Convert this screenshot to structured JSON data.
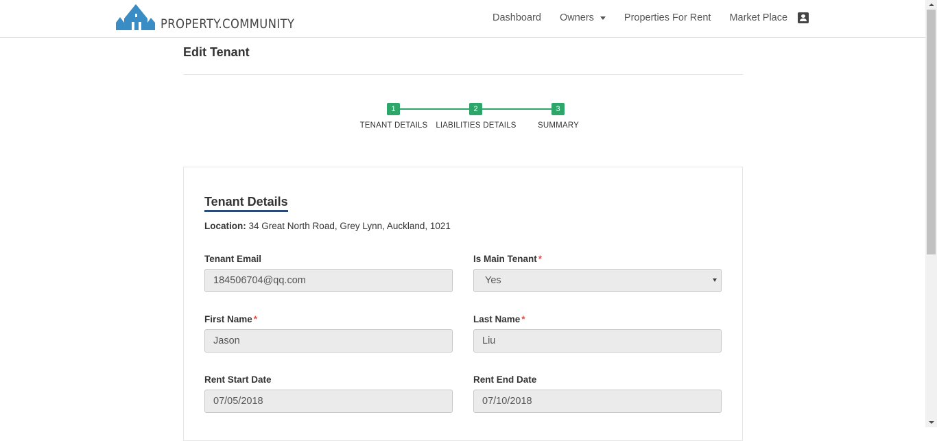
{
  "header": {
    "logo_text": "PROPERTY.COMMUNITY",
    "nav": {
      "dashboard": "Dashboard",
      "owners": "Owners",
      "properties_for_rent": "Properties For Rent",
      "market_place": "Market Place"
    },
    "user_icon": "account-box-icon"
  },
  "page": {
    "title": "Edit Tenant"
  },
  "stepper": {
    "steps": [
      {
        "number": "1",
        "label": "TENANT DETAILS"
      },
      {
        "number": "2",
        "label": "LIABILITIES DETAILS"
      },
      {
        "number": "3",
        "label": "SUMMARY"
      }
    ],
    "color": "#2ea66a"
  },
  "form": {
    "section_title": "Tenant Details",
    "location_label": "Location:",
    "location_value": "34 Great North Road, Grey Lynn, Auckland, 1021",
    "fields": {
      "tenant_email": {
        "label": "Tenant Email",
        "value": "184506704@qq.com"
      },
      "is_main_tenant": {
        "label": "Is Main Tenant",
        "value": "Yes",
        "required": "*"
      },
      "first_name": {
        "label": "First Name",
        "value": "Jason",
        "required": "*"
      },
      "last_name": {
        "label": "Last Name",
        "value": "Liu",
        "required": "*"
      },
      "rent_start_date": {
        "label": "Rent Start Date",
        "value": "07/05/2018"
      },
      "rent_end_date": {
        "label": "Rent End Date",
        "value": "07/10/2018"
      }
    }
  },
  "colors": {
    "brand_blue": "#3a8cc4",
    "step_green": "#2ea66a",
    "section_underline": "#2a4a7a",
    "required_red": "#d9534f"
  }
}
